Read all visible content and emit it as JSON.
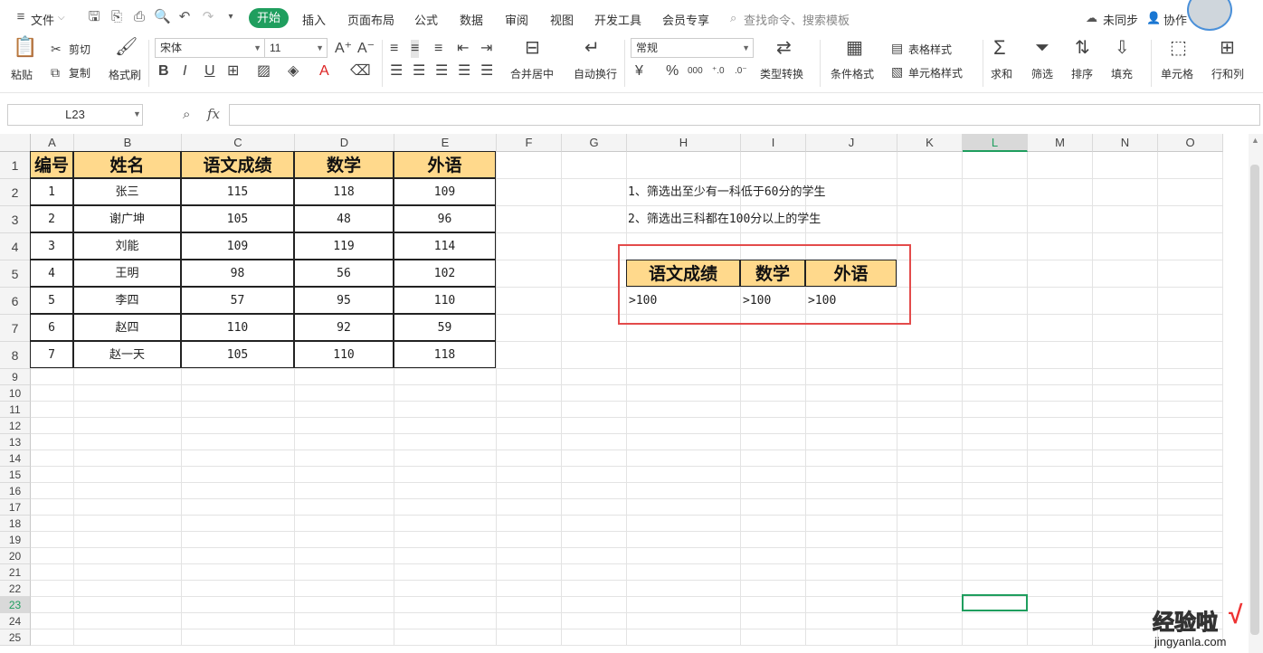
{
  "menubar": {
    "file": "文件",
    "tabs": [
      "开始",
      "插入",
      "页面布局",
      "公式",
      "数据",
      "审阅",
      "视图",
      "开发工具",
      "会员专享"
    ],
    "search_placeholder": "查找命令、搜索模板",
    "sync": "未同步",
    "collab": "协作"
  },
  "ribbon": {
    "paste": "粘贴",
    "cut": "剪切",
    "copy": "复制",
    "format_painter": "格式刷",
    "font_name": "宋体",
    "font_size": "11",
    "merge_center": "合并居中",
    "wrap_text": "自动换行",
    "number_format": "常规",
    "currency": "¥",
    "percent": "%",
    "thousands": "000",
    "type_convert": "类型转换",
    "cond_format": "条件格式",
    "table_style": "表格样式",
    "cell_style": "单元格样式",
    "sum": "求和",
    "filter": "筛选",
    "sort": "排序",
    "fill": "填充",
    "cell": "单元格",
    "row_col": "行和列"
  },
  "formula_bar": {
    "name_box": "L23",
    "fx": "fx",
    "formula": ""
  },
  "sheet": {
    "columns": [
      "A",
      "B",
      "C",
      "D",
      "E",
      "F",
      "G",
      "H",
      "I",
      "J",
      "K",
      "L",
      "M",
      "N",
      "O"
    ],
    "rows": [
      "1",
      "2",
      "3",
      "4",
      "5",
      "6",
      "7",
      "8",
      "9",
      "10",
      "11",
      "12",
      "13",
      "14",
      "15",
      "16",
      "17",
      "18",
      "19",
      "20",
      "21",
      "22",
      "23",
      "24",
      "25"
    ],
    "table_header": [
      "编号",
      "姓名",
      "语文成绩",
      "数学",
      "外语"
    ],
    "table_rows": [
      [
        "1",
        "张三",
        "115",
        "118",
        "109"
      ],
      [
        "2",
        "谢广坤",
        "105",
        "48",
        "96"
      ],
      [
        "3",
        "刘能",
        "109",
        "119",
        "114"
      ],
      [
        "4",
        "王明",
        "98",
        "56",
        "102"
      ],
      [
        "5",
        "李四",
        "57",
        "95",
        "110"
      ],
      [
        "6",
        "赵四",
        "110",
        "92",
        "59"
      ],
      [
        "7",
        "赵一天",
        "105",
        "110",
        "118"
      ]
    ],
    "notes": [
      "1、筛选出至少有一科低于60分的学生",
      "2、筛选出三科都在100分以上的学生"
    ],
    "criteria_header": [
      "语文成绩",
      "数学",
      "外语"
    ],
    "criteria_row": [
      ">100",
      ">100",
      ">100"
    ],
    "selected_cell": "L23"
  },
  "watermark": {
    "text": "经验啦",
    "check": "√",
    "url": "jingyanla.com"
  },
  "colors": {
    "accent": "#1f9e5e",
    "header_fill": "#ffd98c",
    "highlight_box": "#e34b4b"
  }
}
